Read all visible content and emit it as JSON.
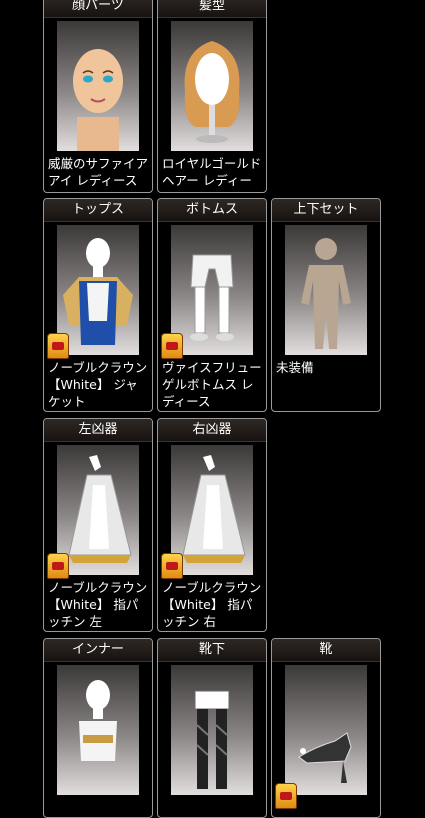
{
  "slots": [
    {
      "header": "顔パーツ",
      "item": "威厳のサファイアアイ レディース",
      "icon": "face-icon",
      "badge": false
    },
    {
      "header": "髪型",
      "item": "ロイヤルゴールド ヘアー レディース",
      "icon": "hair-icon",
      "badge": false
    },
    {
      "header": "トップス",
      "item": "ノーブルクラウン 【White】 ジャケット",
      "icon": "jacket-icon",
      "badge": true
    },
    {
      "header": "ボトムス",
      "item": "ヴァイスフリューゲルボトムス レディース",
      "icon": "pants-icon",
      "badge": true
    },
    {
      "header": "上下セット",
      "item": "未装備",
      "icon": "body-silhouette-icon",
      "badge": false
    },
    {
      "header": "左凶器",
      "item": "ノーブルクラウン 【White】 指パッチン 左",
      "icon": "left-weapon-icon",
      "badge": true
    },
    {
      "header": "右凶器",
      "item": "ノーブルクラウン 【White】 指パッチン 右",
      "icon": "right-weapon-icon",
      "badge": true
    },
    {
      "header": "インナー",
      "item": "",
      "icon": "inner-icon",
      "badge": false
    },
    {
      "header": "靴下",
      "item": "",
      "icon": "socks-icon",
      "badge": false
    },
    {
      "header": "靴",
      "item": "",
      "icon": "shoes-icon",
      "badge": true
    }
  ],
  "colors": {
    "background": "#000000",
    "card_border": "#9a9a9a",
    "header_bg": "#231e1b",
    "badge": "#f0b030"
  }
}
